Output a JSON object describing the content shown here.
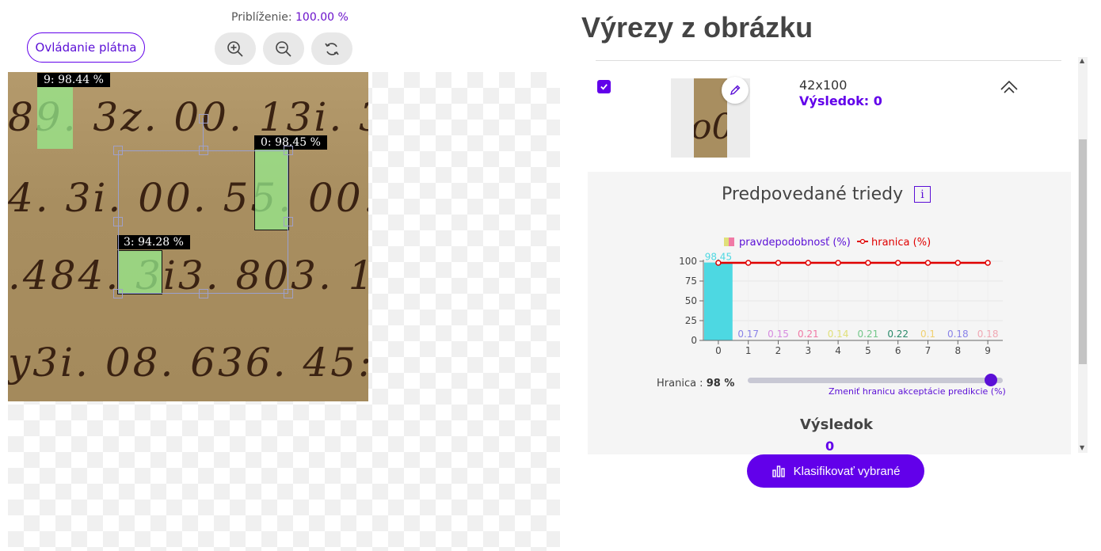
{
  "toolbar": {
    "zoom_label": "Priblíženie:",
    "zoom_value": "100.00 %",
    "canvas_controls_label": "Ovládanie plátna",
    "zoom_in_icon": "zoom-in-icon",
    "zoom_out_icon": "zoom-out-icon",
    "reset_icon": "rotate-reset-icon"
  },
  "canvas": {
    "detections": [
      {
        "label": "9: 98.44 %"
      },
      {
        "label": "0: 98.45 %"
      },
      {
        "label": "3: 94.28 %"
      }
    ]
  },
  "panel": {
    "title": "Výrezy z obrázku",
    "crop": {
      "checked": true,
      "size": "42x100",
      "result": "Výsledok: 0"
    },
    "predictions_title": "Predpovedané triedy",
    "info_icon_glyph": "i",
    "threshold_label": "Hranica :",
    "threshold_value": "98 %",
    "threshold_hint": "Zmeniť hranicu akceptácie predikcie (%)",
    "output_title": "Výsledok",
    "output_value": "0",
    "classify_button": "Klasifikovať vybrané"
  },
  "colors": {
    "accent": "#6200ea",
    "threshold_line": "#e00000"
  },
  "chart_data": {
    "type": "bar",
    "categories": [
      "0",
      "1",
      "2",
      "3",
      "4",
      "5",
      "6",
      "7",
      "8",
      "9"
    ],
    "series": [
      {
        "name": "pravdepodobnosť (%)",
        "values": [
          98.45,
          0.17,
          0.15,
          0.21,
          0.14,
          0.21,
          0.22,
          0.1,
          0.18,
          0.18
        ],
        "data_labels": [
          "98.45",
          "0.17",
          "0.15",
          "0.21",
          "0.14",
          "0.21",
          "0.22",
          "0.1",
          "0.18",
          "0.18"
        ],
        "colors": [
          "#4dd8e2",
          "#8a83e8",
          "#d68ae0",
          "#f07aa6",
          "#e0e07a",
          "#74c78a",
          "#2a8a6a",
          "#f0d070",
          "#8a83e8",
          "#f0a8b4"
        ]
      },
      {
        "name": "hranica (%)",
        "type": "line",
        "values": [
          98,
          98,
          98,
          98,
          98,
          98,
          98,
          98,
          98,
          98
        ]
      }
    ],
    "yticks": [
      "0",
      "25",
      "50",
      "75",
      "100"
    ],
    "ylim": [
      0,
      100
    ],
    "legend_position": "top"
  }
}
